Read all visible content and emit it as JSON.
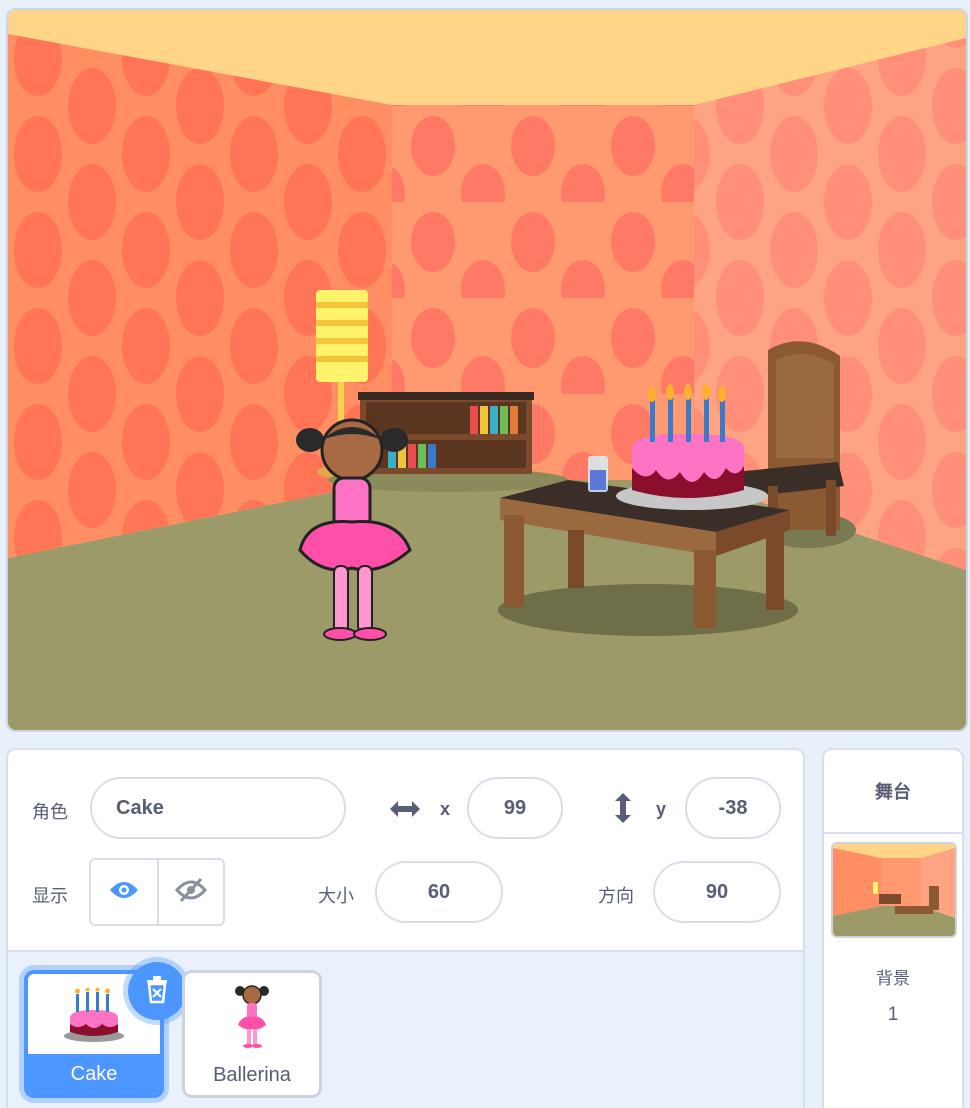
{
  "stage": {
    "colors": {
      "wall": "#ff8f63",
      "floor": "#9b9a68",
      "ceiling": "#ffd587",
      "accent": "#4c97ff"
    }
  },
  "sprite_info": {
    "sprite_label": "角色",
    "sprite_name": "Cake",
    "x_label": "x",
    "x_value": "99",
    "y_label": "y",
    "y_value": "-38",
    "show_label": "显示",
    "size_label": "大小",
    "size_value": "60",
    "direction_label": "方向",
    "direction_value": "90",
    "icons": {
      "x": "horizontal-arrows-icon",
      "y": "vertical-arrows-icon",
      "show": "eye-icon",
      "hide": "eye-slash-icon"
    }
  },
  "sprites": [
    {
      "name": "Cake",
      "selected": true,
      "icon": "cake-thumbnail"
    },
    {
      "name": "Ballerina",
      "selected": false,
      "icon": "ballerina-thumbnail"
    }
  ],
  "stage_panel": {
    "title": "舞台",
    "backdrop_label": "背景",
    "backdrop_count": "1"
  }
}
